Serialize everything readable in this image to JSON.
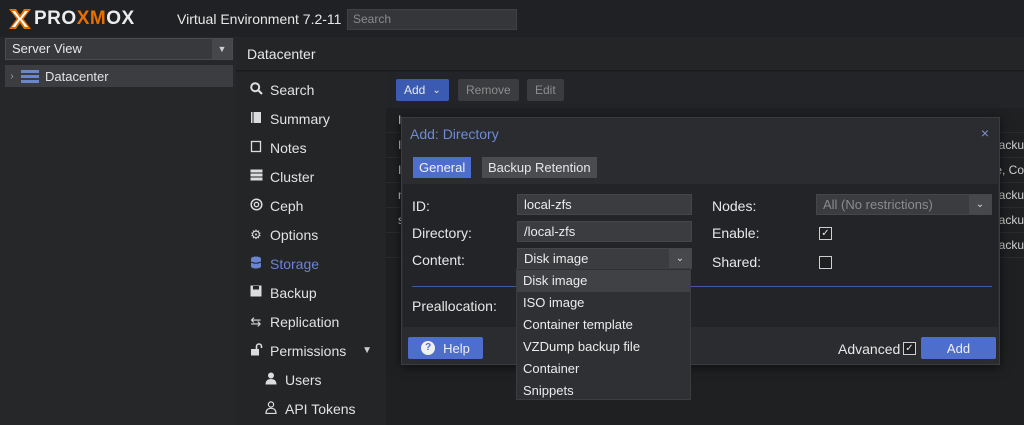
{
  "app": {
    "logo_text_pre": "PR",
    "logo_text_o": "O",
    "logo_text_mid": "XM",
    "logo_text_o2": "O",
    "logo_text_post": "X",
    "version_label": "Virtual Environment 7.2-11",
    "search_placeholder": "Search"
  },
  "colors": {
    "accent": "#4d6ecd",
    "logo_orange": "#e57000",
    "active_nav": "#6a84d0"
  },
  "tree": {
    "view_select": "Server View",
    "root": "Datacenter"
  },
  "header": {
    "title": "Datacenter"
  },
  "nav": {
    "items": [
      {
        "label": "Search",
        "icon": "search-icon"
      },
      {
        "label": "Summary",
        "icon": "book-icon"
      },
      {
        "label": "Notes",
        "icon": "note-icon"
      },
      {
        "label": "Cluster",
        "icon": "server-icon"
      },
      {
        "label": "Ceph",
        "icon": "ceph-icon"
      },
      {
        "label": "Options",
        "icon": "gear-icon"
      },
      {
        "label": "Storage",
        "icon": "database-icon"
      },
      {
        "label": "Backup",
        "icon": "floppy-icon"
      },
      {
        "label": "Replication",
        "icon": "retweet-icon"
      },
      {
        "label": "Permissions",
        "icon": "unlock-icon"
      },
      {
        "label": "Users",
        "icon": "user-icon"
      },
      {
        "label": "API Tokens",
        "icon": "user-outline-icon"
      }
    ],
    "active": "Storage"
  },
  "toolbar": {
    "add": "Add",
    "remove": "Remove",
    "edit": "Edit"
  },
  "grid": {
    "rows": [
      {
        "lead": "I",
        "tail": ""
      },
      {
        "lead": "I",
        "tail": "backu"
      },
      {
        "lead": "I",
        "tail": "e, Co"
      },
      {
        "lead": "n",
        "tail": "backu"
      },
      {
        "lead": "s",
        "tail": "backu"
      },
      {
        "lead": "",
        "tail": "backu"
      }
    ]
  },
  "dialog": {
    "title": "Add: Directory",
    "close": "×",
    "tabs": {
      "general": "General",
      "retention": "Backup Retention"
    },
    "labels": {
      "id": "ID:",
      "directory": "Directory:",
      "content": "Content:",
      "preallocation": "Preallocation:",
      "nodes": "Nodes:",
      "enable": "Enable:",
      "shared": "Shared:"
    },
    "values": {
      "id": "local-zfs",
      "directory": "/local-zfs",
      "content": "Disk image",
      "nodes": "All (No restrictions)"
    },
    "enable_checked": true,
    "shared_checked": false,
    "advanced_label": "Advanced",
    "advanced_checked": true,
    "help_label": "Help",
    "add_label": "Add"
  },
  "content_dropdown": {
    "options": [
      "Disk image",
      "ISO image",
      "Container template",
      "VZDump backup file",
      "Container",
      "Snippets"
    ],
    "selected": "Disk image"
  }
}
